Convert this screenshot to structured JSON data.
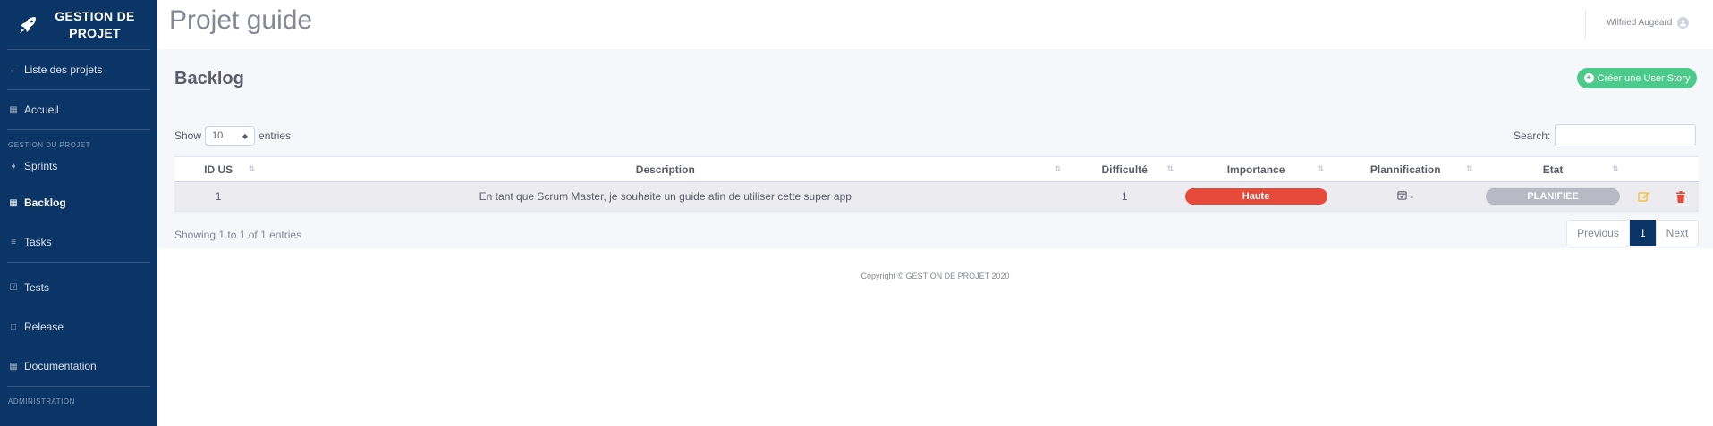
{
  "brand": {
    "name": "GESTION DE PROJET",
    "line1": "GESTION DE",
    "line2": "PROJET"
  },
  "sidebar": {
    "items": [
      {
        "label": "Liste des projets",
        "icon": "arrow-left-icon"
      },
      {
        "label": "Accueil",
        "icon": "calendar-icon"
      },
      {
        "label": "Sprints",
        "icon": "flame-icon"
      },
      {
        "label": "Backlog",
        "icon": "table-icon",
        "active": true
      },
      {
        "label": "Tasks",
        "icon": "list-icon"
      },
      {
        "label": "Tests",
        "icon": "check-square-icon"
      },
      {
        "label": "Release",
        "icon": "file-icon"
      },
      {
        "label": "Documentation",
        "icon": "book-icon"
      }
    ],
    "section_project": "GESTION DU PROJET",
    "section_admin": "ADMINISTRATION"
  },
  "header": {
    "title": "Projet guide",
    "user": "Wilfried Augeard"
  },
  "main": {
    "section_title": "Backlog",
    "create_button": "Créer une User Story",
    "show_label": "Show",
    "entries_label": "entries",
    "page_size": "10",
    "search_label": "Search:",
    "search_value": ""
  },
  "table": {
    "columns": [
      "ID US",
      "Description",
      "Difficulté",
      "Importance",
      "Plannification",
      "Etat"
    ],
    "rows": [
      {
        "id": "1",
        "description": "En tant que Scrum Master, je souhaite un guide afin de utiliser cette super app",
        "difficulty": "1",
        "importance": "Haute",
        "planning": "-",
        "state": "PLANIFIEE"
      }
    ]
  },
  "pagination": {
    "info": "Showing 1 to 1 of 1 entries",
    "previous": "Previous",
    "current": "1",
    "next": "Next"
  },
  "footer": {
    "copyright": "Copyright © GESTION DE PROJET 2020"
  },
  "colors": {
    "sidebar": "#0b3566",
    "accent_green": "#4cca8b",
    "danger": "#e74a3b",
    "warning": "#f6c23e",
    "muted": "#b7b9c4"
  }
}
